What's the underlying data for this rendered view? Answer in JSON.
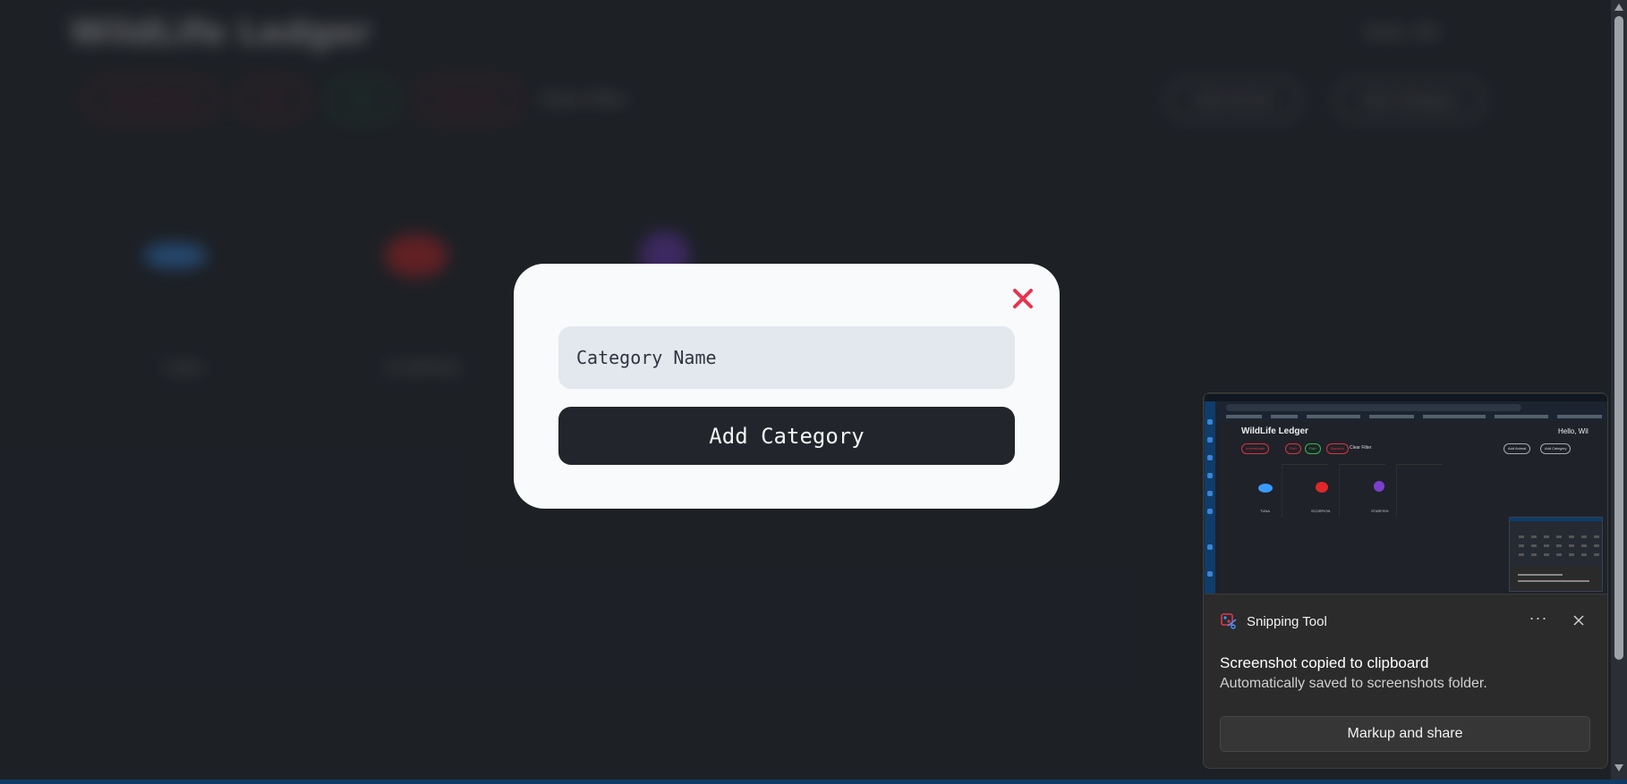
{
  "background_app": {
    "title": "WildLife Ledger",
    "greeting": "Hello, Wil",
    "filters": [
      {
        "label": "Invertebrate",
        "color": "#e0313e"
      },
      {
        "label": "Fish",
        "color": "#e0313e"
      },
      {
        "label": "Fish",
        "color": "#2fbf4a"
      },
      {
        "label": "Bacteria",
        "color": "#e0313e"
      }
    ],
    "clear_filter": "Clear Filter",
    "actions": [
      "Add Animal",
      "Add Category"
    ],
    "cards": [
      {
        "label": "TUNA",
        "color": "#3a9bff"
      },
      {
        "label": "SCORPION",
        "color": "#e02828"
      },
      {
        "label": "STARFISH",
        "color": "#7b3fcf"
      }
    ]
  },
  "modal": {
    "close_icon": "close-icon",
    "close_color": "#e8334f",
    "input_placeholder": "Category Name",
    "input_value": "",
    "submit_label": "Add Category"
  },
  "toast": {
    "app_icon": "snipping-tool-icon",
    "app_name": "Snipping Tool",
    "more_label": "···",
    "message_title": "Screenshot copied to clipboard",
    "message_body": "Automatically saved to screenshots folder.",
    "action_label": "Markup and share"
  }
}
